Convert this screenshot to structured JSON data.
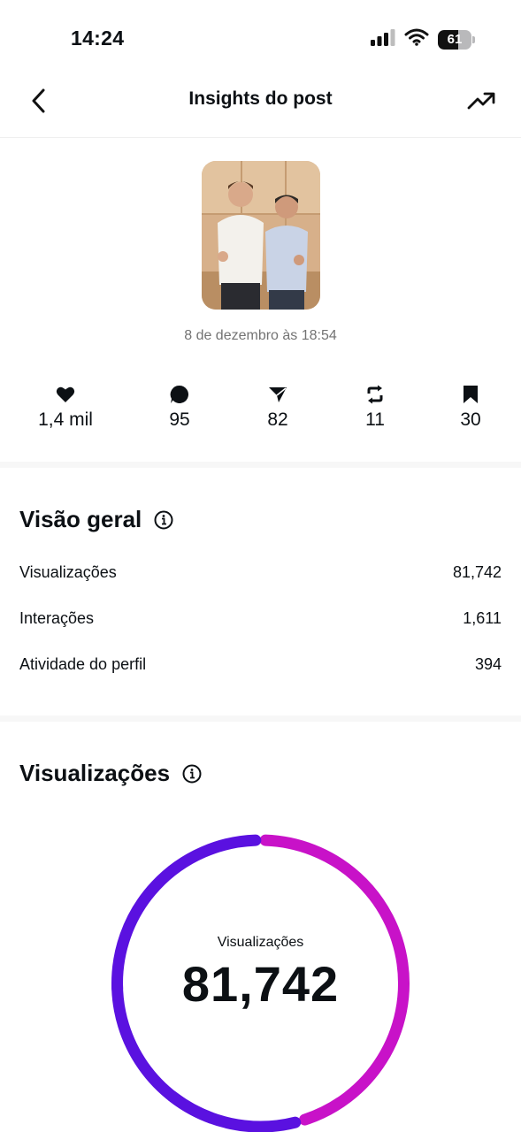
{
  "status_bar": {
    "time": "14:24",
    "battery_level": "61"
  },
  "header": {
    "title": "Insights do post"
  },
  "post": {
    "date": "8 de dezembro às 18:54"
  },
  "metrics": [
    {
      "icon": "heart-icon",
      "value": "1,4 mil"
    },
    {
      "icon": "comment-icon",
      "value": "95"
    },
    {
      "icon": "share-icon",
      "value": "82"
    },
    {
      "icon": "repost-icon",
      "value": "11"
    },
    {
      "icon": "save-icon",
      "value": "30"
    }
  ],
  "overview": {
    "title": "Visão geral",
    "rows": [
      {
        "label": "Visualizações",
        "value": "81,742"
      },
      {
        "label": "Interações",
        "value": "1,611"
      },
      {
        "label": "Atividade do perfil",
        "value": "394"
      }
    ]
  },
  "views": {
    "title": "Visualizações",
    "donut_label": "Visualizações",
    "donut_value": "81,742",
    "segments": [
      {
        "color": "#5a11e0",
        "fraction_start": 0.0,
        "fraction_end": 0.45
      },
      {
        "color": "#c812c8",
        "fraction_start": 0.45,
        "fraction_end": 0.8
      },
      {
        "color": "#5a11e0",
        "fraction_start": 0.8,
        "fraction_end": 1.0
      }
    ]
  },
  "colors": {
    "accent_purple": "#5a11e0",
    "accent_magenta": "#c812c8",
    "muted_text": "#737373"
  }
}
